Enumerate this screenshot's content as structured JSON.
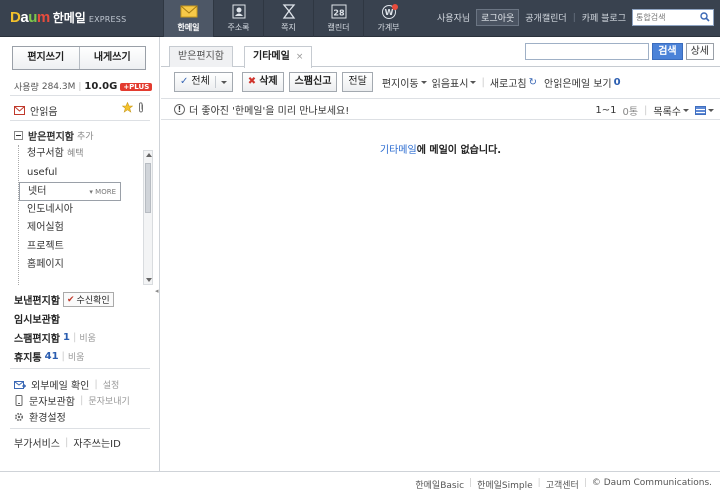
{
  "topbar": {
    "brand": "Daum",
    "title": "한메일",
    "subtitle": "EXPRESS",
    "apps": [
      {
        "label": "한메일",
        "icon": "mail-icon"
      },
      {
        "label": "주소록",
        "icon": "contacts-icon"
      },
      {
        "label": "쪽지",
        "icon": "note-icon"
      },
      {
        "label": "캘린더",
        "icon": "calendar-icon",
        "day": "28"
      },
      {
        "label": "가계부",
        "icon": "ledger-icon",
        "mark": "W"
      }
    ],
    "user_label": "사용자님",
    "logout": "로그아웃",
    "links": [
      "공개캘린더",
      "카페 블로그"
    ],
    "search_placeholder": "통합검색"
  },
  "sidebar": {
    "compose": "편지쓰기",
    "self_compose": "내게쓰기",
    "usage_label": "사용량",
    "usage_value": "284.3M",
    "capacity": "10.0G",
    "plus": "+PLUS",
    "unread": "안읽음",
    "inbox": "받은편지함",
    "inbox_add": "추가",
    "folders": [
      {
        "name": "청구서함",
        "sub": "혜택"
      },
      {
        "name": "useful",
        "sub": ""
      },
      {
        "name": "넷터",
        "sub": "",
        "more": "MORE"
      },
      {
        "name": "인도네시아",
        "sub": ""
      },
      {
        "name": "제어실험",
        "sub": ""
      },
      {
        "name": "프로젝트",
        "sub": ""
      },
      {
        "name": "홈페이지",
        "sub": ""
      }
    ],
    "sent": "보낸편지함",
    "read_receipt": "수신확인",
    "temp": "임시보관함",
    "spam": "스팸편지함",
    "spam_count": "1",
    "spam_empty": "비움",
    "trash": "휴지통",
    "trash_count": "41",
    "trash_empty": "비움",
    "external_mail": "외부메일 확인",
    "external_settings": "설정",
    "sms_box": "문자보관함",
    "sms_send": "문자보내기",
    "settings": "환경설정",
    "addons": "부가서비스",
    "faq": "자주쓰는ID"
  },
  "main": {
    "tabs": [
      {
        "label": "받은편지함"
      },
      {
        "label": "기타메일",
        "close": "×"
      }
    ],
    "search_button": "검색",
    "detail_button": "상세",
    "toolbar": {
      "all": "전체",
      "delete": "삭제",
      "spam_report": "스팸신고",
      "forward": "전달",
      "move": "편지이동",
      "mark_read": "읽음표시",
      "refresh": "새로고침",
      "unread_view": "안읽은메일 보기",
      "unread_count": "0"
    },
    "info_text": "더 좋아진 '한메일'을 미리 만나보세요!",
    "page_range": "1~1",
    "page_count": "0통",
    "list_count": "목록수",
    "empty_folder": "기타메일",
    "empty_text": "에 메일이 없습니다."
  },
  "footer": {
    "links": [
      "한메일Basic",
      "한메일Simple",
      "고객센터",
      "© Daum Communications."
    ]
  },
  "colors": {
    "topbar": "#39424f",
    "accent_blue": "#4b82d8",
    "link_blue": "#2a6bd0",
    "plus_red": "#e33b2f"
  }
}
